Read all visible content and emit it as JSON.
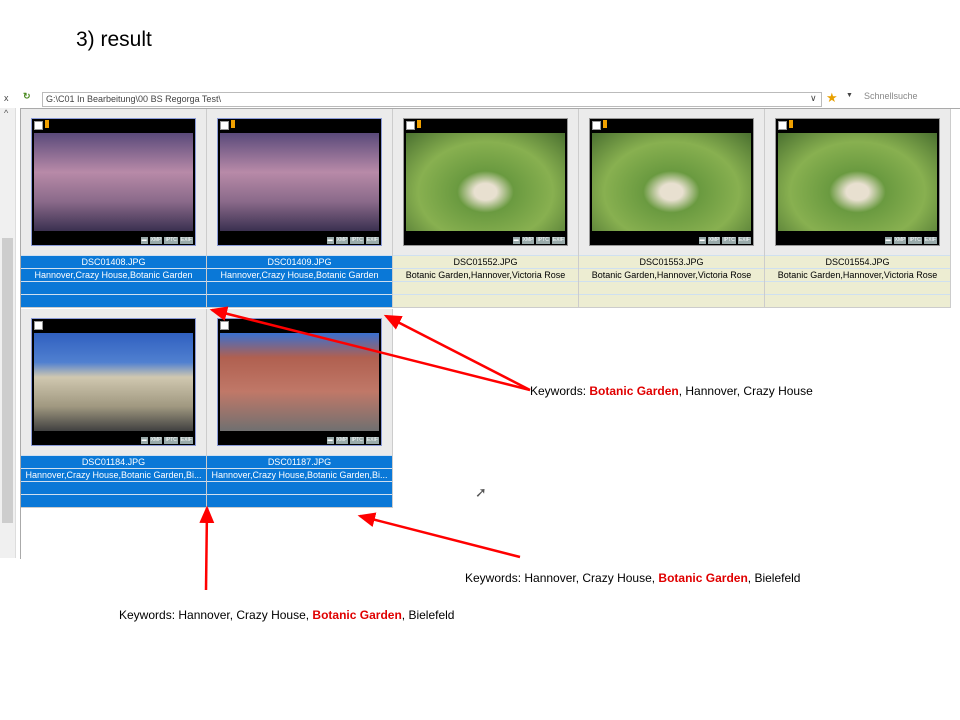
{
  "slide_title": "3) result",
  "toolbar": {
    "path": "G:\\C01 In Bearbeitung\\00 BS Regorga Test\\",
    "search_placeholder": "Schnellsuche"
  },
  "badges": [
    "XMP",
    "IPTC",
    "EXIF"
  ],
  "images": [
    {
      "file": "DSC01408.JPG",
      "keywords": "Hannover,Crazy House,Botanic Garden",
      "state": "sel",
      "img": "house"
    },
    {
      "file": "DSC01409.JPG",
      "keywords": "Hannover,Crazy House,Botanic Garden",
      "state": "sel",
      "img": "house"
    },
    {
      "file": "DSC01552.JPG",
      "keywords": "Botanic Garden,Hannover,Victoria Rose",
      "state": "yellow",
      "img": "lily"
    },
    {
      "file": "DSC01553.JPG",
      "keywords": "Botanic Garden,Hannover,Victoria Rose",
      "state": "yellow",
      "img": "lily"
    },
    {
      "file": "DSC01554.JPG",
      "keywords": "Botanic Garden,Hannover,Victoria Rose",
      "state": "yellow",
      "img": "lily"
    },
    {
      "file": "DSC01184.JPG",
      "keywords": "Hannover,Crazy House,Botanic Garden,Bi...",
      "state": "sel",
      "img": "church"
    },
    {
      "file": "DSC01187.JPG",
      "keywords": "Hannover,Crazy House,Botanic Garden,Bi...",
      "state": "sel",
      "img": "timber"
    }
  ],
  "notes": [
    {
      "prefix": "Keywords: ",
      "hl": "Botanic Garden",
      "suffix": ", Hannover, Crazy House"
    },
    {
      "prefix": "Keywords: Hannover, Crazy House, ",
      "hl": "Botanic Garden",
      "suffix": ", Bielefeld"
    },
    {
      "prefix": "Keywords: Hannover, Crazy House, ",
      "hl": "Botanic Garden",
      "suffix": ", Bielefeld"
    }
  ],
  "colors": {
    "selected": "#0a78d7",
    "highlight": "#e00000",
    "arrow": "#ff0000"
  }
}
